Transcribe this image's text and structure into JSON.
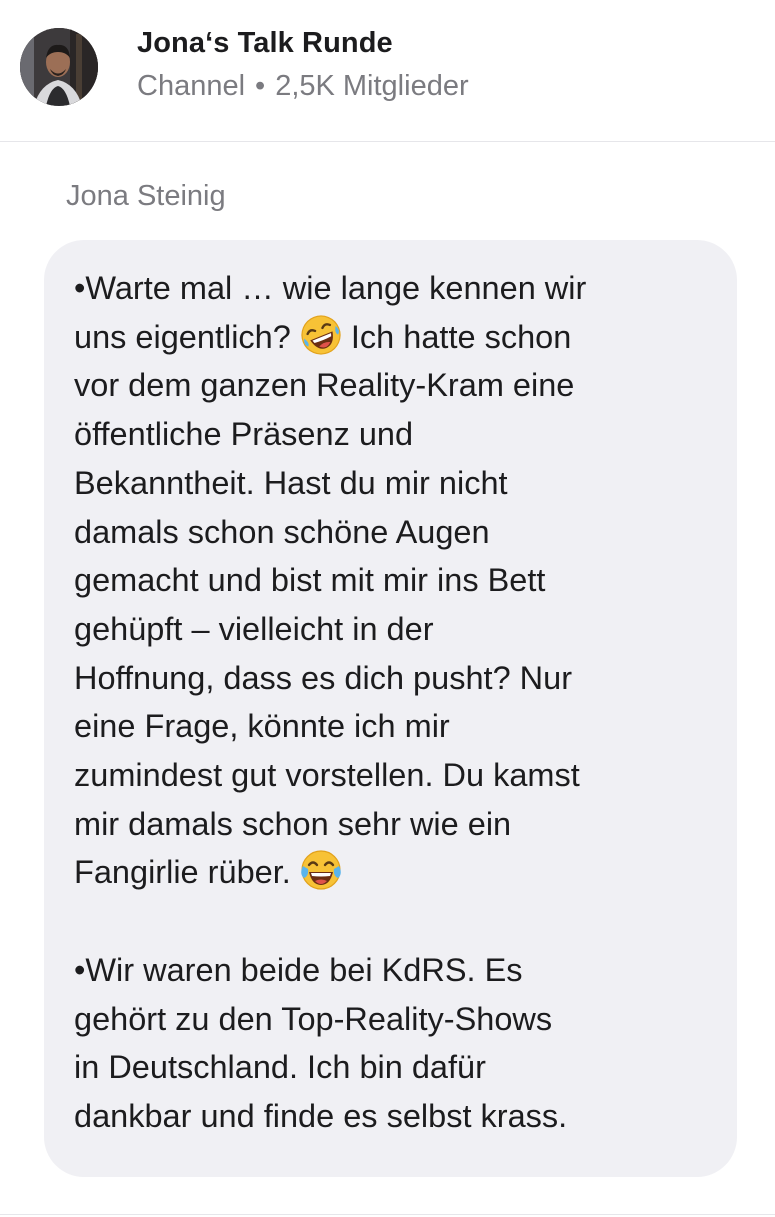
{
  "header": {
    "channel_name": "Jona‘s Talk Runde",
    "channel_type": "Channel",
    "separator": "•",
    "member_count": "2,5K Mitglieder",
    "avatar_icon": "profile-photo-avatar"
  },
  "message": {
    "sender": "Jona Steinig",
    "paragraph1": {
      "line1": "•Warte mal … wie lange kennen wir",
      "line2_before": "uns eigentlich? ",
      "line2_after": " Ich hatte schon",
      "line3": "vor dem ganzen Reality-Kram eine",
      "line4": "öffentliche Präsenz und",
      "line5": "Bekanntheit. Hast du mir nicht",
      "line6": "damals schon schöne Augen",
      "line7": "gemacht und bist mit mir ins Bett",
      "line8": "gehüpft – vielleicht in der",
      "line9": "Hoffnung, dass es dich pusht? Nur",
      "line10": "eine Frage, könnte ich mir",
      "line11": "zumindest gut vorstellen. Du kamst",
      "line12": "mir damals schon sehr wie ein",
      "line13": "Fangirlie rüber. "
    },
    "paragraph2": {
      "line1": "•Wir waren beide bei KdRS. Es",
      "line2": "gehört zu den Top-Reality-Shows",
      "line3": "in Deutschland. Ich bin dafür",
      "line4": "dankbar und finde es selbst krass."
    },
    "emoji1": "rolling-on-floor-laughing-emoji",
    "emoji2": "face-with-tears-of-joy-emoji"
  },
  "colors": {
    "bubble_background": "#f0f0f4",
    "text_primary": "#1c1c1e",
    "text_secondary": "#7b7b80",
    "emoji_yellow": "#f7c236"
  }
}
